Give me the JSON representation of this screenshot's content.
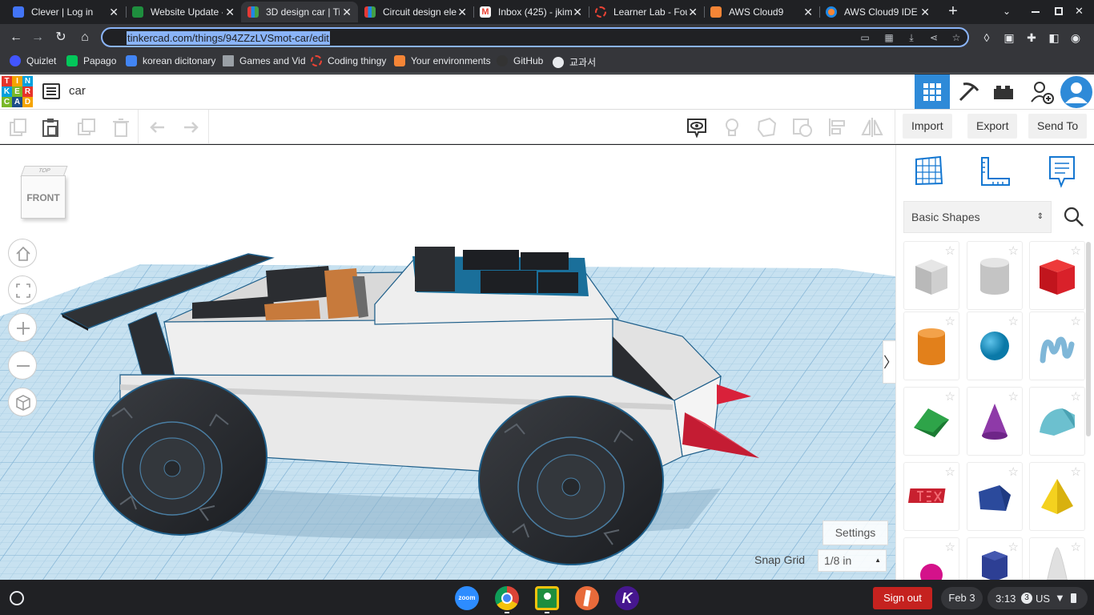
{
  "browser": {
    "tabs": [
      {
        "title": "Clever | Log in",
        "icon": "clever-icon",
        "color": "#4274f6"
      },
      {
        "title": "Website Update - G",
        "icon": "classroom-icon",
        "color": "#1e8e3e"
      },
      {
        "title": "3D design car | Ti",
        "icon": "tinkercad-icon",
        "color": "#e8eaed",
        "active": true
      },
      {
        "title": "Circuit design ele",
        "icon": "tinkercad-icon",
        "color": "#e8eaed"
      },
      {
        "title": "Inbox (425) - jkim",
        "icon": "gmail-icon",
        "color": "#ea4335"
      },
      {
        "title": "Learner Lab - Fou",
        "icon": "learner-lab-icon",
        "color": "#ea4335"
      },
      {
        "title": "AWS Cloud9",
        "icon": "aws-icon",
        "color": "#f58536"
      },
      {
        "title": "AWS Cloud9 IDE",
        "icon": "cloud9-icon",
        "color": "#f58536"
      }
    ],
    "url": "tinkercad.com/things/94ZZzLVSmot-car/edit",
    "bookmarks": [
      {
        "label": "Quizlet",
        "color": "#4255ff"
      },
      {
        "label": "Papago",
        "color": "#03c75a"
      },
      {
        "label": "korean dicitonary",
        "color": "#4285f4"
      },
      {
        "label": "Games and Vid",
        "color": "#9aa0a6",
        "folder": true
      },
      {
        "label": "Coding thingy",
        "color": "#ea4335"
      },
      {
        "label": "Your environments",
        "color": "#f58536"
      },
      {
        "label": "GitHub",
        "color": "#333333"
      },
      {
        "label": "교과서",
        "color": "#e8eaed"
      }
    ]
  },
  "tinkercad": {
    "logo_letters": [
      "T",
      "I",
      "N",
      "K",
      "E",
      "R",
      "C",
      "A",
      "D"
    ],
    "design_name": "car",
    "toolbar": {
      "import_label": "Import",
      "export_label": "Export",
      "send_to_label": "Send To"
    },
    "viewcube": {
      "front_label": "FRONT",
      "top_label": "TOP"
    },
    "settings_label": "Settings",
    "snap_grid_label": "Snap Grid",
    "snap_grid_value": "1/8 in",
    "shape_category": "Basic Shapes",
    "colors": {
      "accent": "#1477d1",
      "blue_header": "#2e8ad8"
    }
  },
  "taskbar": {
    "sign_out_label": "Sign out",
    "date": "Feb 3",
    "time": "3:13",
    "badge": "3",
    "locale": "US",
    "apps": [
      "zoom-icon",
      "chrome-icon",
      "classroom-icon",
      "sketch-icon",
      "kahoot-icon"
    ]
  }
}
